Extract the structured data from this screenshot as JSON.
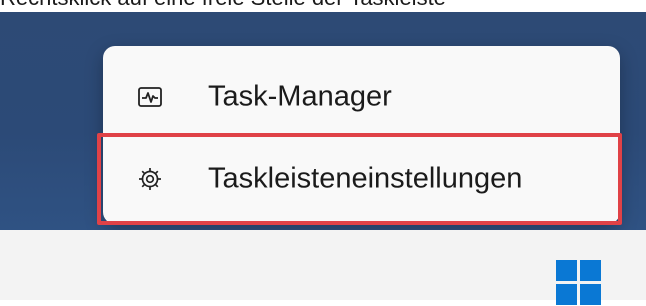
{
  "caption": {
    "text": "Rechtsklick auf eine freie Stelle der Taskleiste"
  },
  "context_menu": {
    "items": [
      {
        "label": "Task-Manager",
        "icon": "task-manager-icon"
      },
      {
        "label": "Taskleisteneinstellungen",
        "icon": "gear-icon"
      }
    ]
  },
  "highlight": {
    "color": "#e04247",
    "target": "Taskleisteneinstellungen"
  },
  "taskbar": {
    "start_icon": "windows-logo-icon",
    "color": "#f3f3f3"
  },
  "colors": {
    "desktop": "#2c4a77",
    "menu_background": "#f9f9f9",
    "start_blue": "#0a78d4"
  }
}
